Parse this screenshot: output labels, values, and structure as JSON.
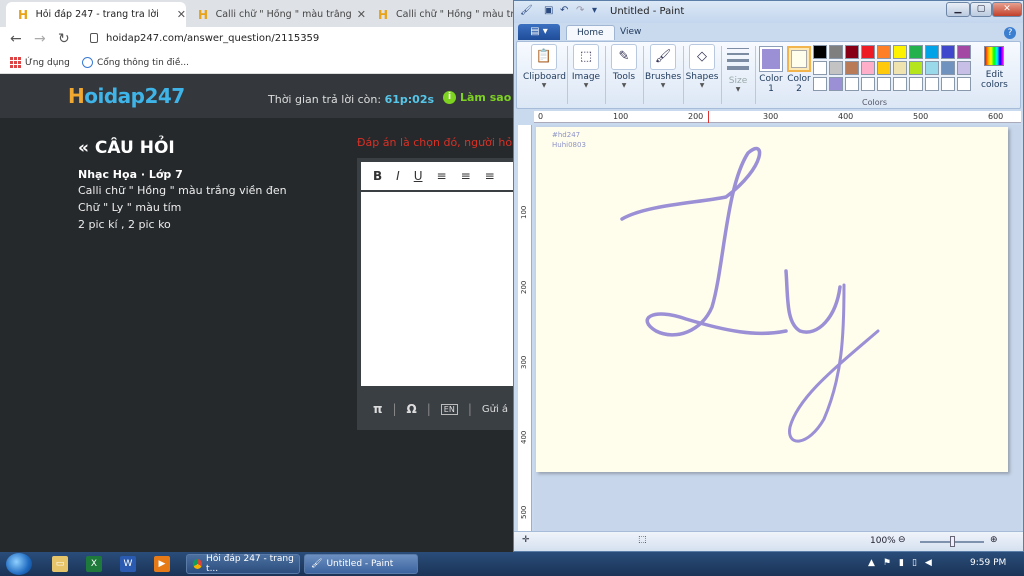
{
  "browser": {
    "tabs": [
      {
        "title": "Hỏi đáp 247 - trang tra lời",
        "active": true
      },
      {
        "title": "Calli chữ \" Hồng \" màu trắng viề",
        "active": false
      },
      {
        "title": "Calli chữ \" Hồng \" màu trắng v",
        "active": false
      }
    ],
    "url": "hoidap247.com/answer_question/2115359",
    "bookmarks": [
      "Ứng dụng",
      "Cổng thông tin điề..."
    ]
  },
  "site": {
    "logo_h": "H",
    "logo_rest": "oidap247",
    "timer_label": "Thời gian trả lời còn:",
    "timer_value": "61p:02s",
    "help_text": "Làm sao đ"
  },
  "question": {
    "heading": "« CÂU HỎI",
    "meta": "Nhạc Họa · Lớp 7",
    "lines": [
      "Calli chữ \" Hồng \" màu trắng viền đen",
      "Chữ \" Ly \" màu tím",
      "2 pic kí , 2 pic ko"
    ],
    "warning": "Đáp án là chọn đó, người hỏi m",
    "send_label": "Gửi á"
  },
  "paint": {
    "title": "Untitled - Paint",
    "file_tab": "▤ ▾",
    "tabs": [
      "Home",
      "View"
    ],
    "groups": {
      "clipboard": "Clipboard",
      "image": "Image",
      "tools": "Tools",
      "brushes": "Brushes",
      "shapes": "Shapes",
      "size": "Size",
      "color1": "Color\n1",
      "color2": "Color\n2",
      "edit_colors": "Edit\ncolors",
      "colors_label": "Colors"
    },
    "color1_value": "#9b8fd6",
    "color2_value": "#fffdec",
    "palette": [
      "#000000",
      "#7f7f7f",
      "#880015",
      "#ed1c24",
      "#ff7f27",
      "#fff200",
      "#22b14c",
      "#00a2e8",
      "#3f48cc",
      "#a349a4",
      "#ffffff",
      "#c3c3c3",
      "#b97a57",
      "#ffaec9",
      "#ffc90e",
      "#efe4b0",
      "#b5e61d",
      "#99d9ea",
      "#7092be",
      "#c8bfe7",
      "#ffffff",
      "#9b8fd6",
      "#ffffff",
      "#ffffff",
      "#ffffff",
      "#ffffff",
      "#ffffff",
      "#ffffff",
      "#ffffff",
      "#ffffff"
    ],
    "ruler_h": [
      "0",
      "100",
      "200",
      "300",
      "400",
      "500",
      "600"
    ],
    "ruler_v": [
      "100",
      "200",
      "300",
      "400",
      "500"
    ],
    "watermark": [
      "#hd247",
      "Huhi0803"
    ],
    "stroke_color": "#9b8fd6",
    "zoom": "100%"
  },
  "taskbar": {
    "buttons": [
      "Hỏi đáp 247 - trang t...",
      "Untitled - Paint"
    ],
    "clock": "9:59 PM"
  }
}
